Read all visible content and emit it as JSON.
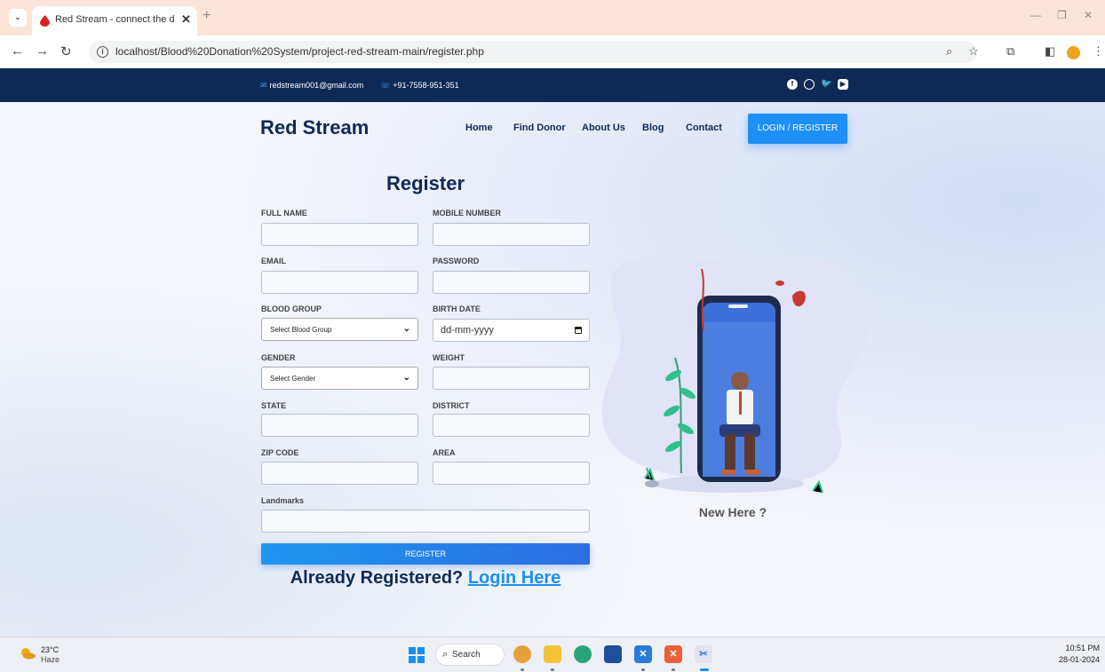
{
  "browser": {
    "tab_title": "Red Stream - connect the donc",
    "url": "localhost/Blood%20Donation%20System/project-red-stream-main/register.php"
  },
  "topbar": {
    "email": "redstream001@gmail.com",
    "phone": "+91-7558-951-351",
    "social_icons": [
      "facebook-icon",
      "instagram-icon",
      "twitter-icon",
      "youtube-icon"
    ]
  },
  "header": {
    "brand": "Red Stream",
    "nav": [
      "Home",
      "Find Donor",
      "About Us",
      "Blog",
      "Contact"
    ],
    "login_button": "LOGIN / REGISTER"
  },
  "form": {
    "title": "Register",
    "labels": {
      "full_name": "FULL NAME",
      "mobile": "MOBILE NUMBER",
      "email": "EMAIL",
      "password": "PASSWORD",
      "blood_group": "BLOOD GROUP",
      "birth_date": "BIRTH DATE",
      "gender": "GENDER",
      "weight": "WEIGHT",
      "state": "STATE",
      "district": "DISTRICT",
      "zip": "ZIP CODE",
      "area": "AREA",
      "landmarks": "Landmarks"
    },
    "blood_group_selected": "Select Blood Group",
    "gender_selected": "Select Gender",
    "birth_date_placeholder": "dd-mm-yyyy",
    "submit": "REGISTER",
    "already_text": "Already Registered?",
    "login_link": "Login Here"
  },
  "illustration": {
    "caption": "New Here ?"
  },
  "taskbar": {
    "temp": "23°C",
    "weather": "Haze",
    "search": "Search",
    "time": "10:51 PM",
    "date": "28-01-2024"
  },
  "colors": {
    "navy": "#0e2a54",
    "accent_blue": "#1e8ff5",
    "tab_bar": "#fde4d8"
  }
}
